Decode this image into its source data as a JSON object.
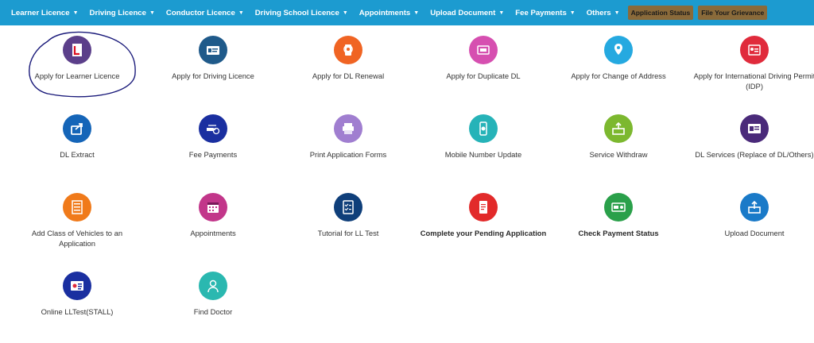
{
  "nav": {
    "items": [
      {
        "label": "Learner Licence"
      },
      {
        "label": "Driving Licence"
      },
      {
        "label": "Conductor Licence"
      },
      {
        "label": "Driving School Licence"
      },
      {
        "label": "Appointments"
      },
      {
        "label": "Upload Document"
      },
      {
        "label": "Fee Payments"
      },
      {
        "label": "Others"
      }
    ],
    "application_status": "Application Status",
    "grievance": "File Your Grievance"
  },
  "tiles": [
    {
      "label": "Apply for Learner Licence",
      "color": "#5b3f8a",
      "icon": "learner-l-icon"
    },
    {
      "label": "Apply for Driving Licence",
      "color": "#1f5a8a",
      "icon": "driving-card-icon"
    },
    {
      "label": "Apply for DL Renewal",
      "color": "#f06423",
      "icon": "renewal-icon"
    },
    {
      "label": "Apply for Duplicate DL",
      "color": "#d64fb0",
      "icon": "duplicate-card-icon"
    },
    {
      "label": "Apply for Change of Address",
      "color": "#25a9e0",
      "icon": "map-pin-icon"
    },
    {
      "label": "Apply for International Driving Permit (IDP)",
      "color": "#e02b3c",
      "icon": "passport-icon"
    },
    {
      "label": "DL Extract",
      "color": "#1565b8",
      "icon": "share-icon"
    },
    {
      "label": "Fee Payments",
      "color": "#1a2fa0",
      "icon": "payment-hand-icon"
    },
    {
      "label": "Print Application Forms",
      "color": "#a07ed0",
      "icon": "printer-icon"
    },
    {
      "label": "Mobile Number Update",
      "color": "#26b3b8",
      "icon": "mobile-icon"
    },
    {
      "label": "Service Withdraw",
      "color": "#7cb82f",
      "icon": "withdraw-icon"
    },
    {
      "label": "DL Services (Replace of DL/Others)",
      "color": "#4a2a7a",
      "icon": "id-card-icon"
    },
    {
      "label": "Add Class of Vehicles to an Application",
      "color": "#f07a1a",
      "icon": "list-doc-icon"
    },
    {
      "label": "Appointments",
      "color": "#c2368a",
      "icon": "calendar-icon"
    },
    {
      "label": "Tutorial for LL Test",
      "color": "#0f3f7a",
      "icon": "checklist-icon"
    },
    {
      "label": "Complete your Pending Application",
      "color": "#e22a2a",
      "icon": "pending-doc-icon",
      "bold": true
    },
    {
      "label": "Check Payment Status",
      "color": "#2aa04a",
      "icon": "payment-status-icon",
      "bold": true
    },
    {
      "label": "Upload Document",
      "color": "#1a7ac8",
      "icon": "upload-icon"
    },
    {
      "label": "Online LLTest(STALL)",
      "color": "#1a2fa0",
      "icon": "ll-test-card-icon"
    },
    {
      "label": "Find Doctor",
      "color": "#2ab8b0",
      "icon": "doctor-icon"
    }
  ]
}
